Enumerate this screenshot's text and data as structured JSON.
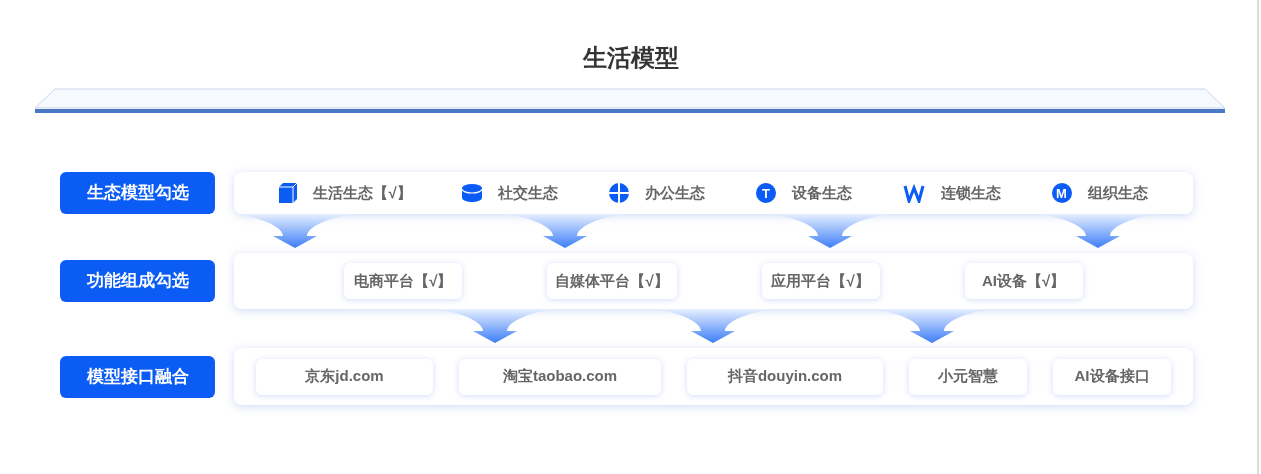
{
  "title": "生活模型",
  "rows": [
    {
      "label": "生态模型勾选",
      "kind": "icons",
      "items": [
        {
          "text": "生活生态【√】"
        },
        {
          "text": "社交生态"
        },
        {
          "text": "办公生态"
        },
        {
          "glyph": "T",
          "text": "设备生态"
        },
        {
          "text": "连锁生态"
        },
        {
          "glyph": "M",
          "text": "组织生态"
        }
      ]
    },
    {
      "label": "功能组成勾选",
      "kind": "chips",
      "items": [
        {
          "text": "电商平台【√】"
        },
        {
          "text": "自媒体平台【√】"
        },
        {
          "text": "应用平台【√】"
        },
        {
          "text": "AI设备【√】"
        }
      ]
    },
    {
      "label": "模型接口融合",
      "kind": "chips",
      "items": [
        {
          "text": "京东jd.com"
        },
        {
          "text": "淘宝taobao.com"
        },
        {
          "text": "抖音douyin.com"
        },
        {
          "text": "小元智慧"
        },
        {
          "text": "AI设备接口"
        }
      ]
    }
  ]
}
